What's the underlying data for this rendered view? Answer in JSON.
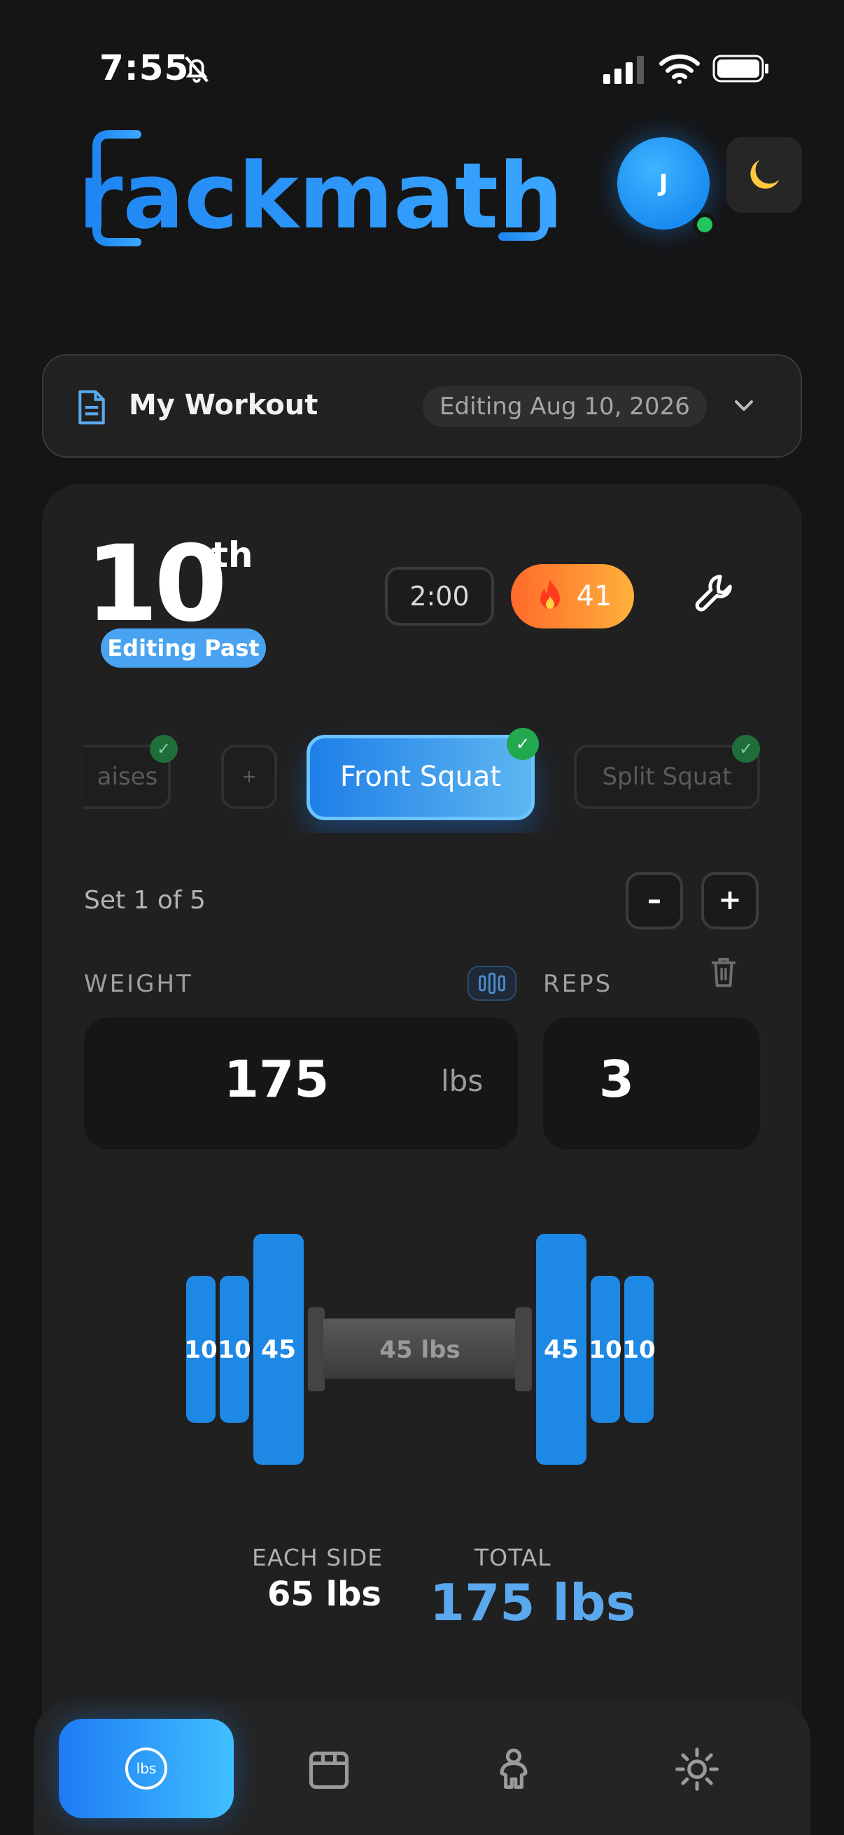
{
  "status_bar": {
    "time": "7:55"
  },
  "brand": {
    "name": "rackmath"
  },
  "profile": {
    "initial": "J",
    "theme_icon": "moon-icon"
  },
  "workout_selector": {
    "title": "My Workout",
    "editing_label": "Editing Aug 10, 2026"
  },
  "day": {
    "number": "10",
    "suffix": "th",
    "badge": "Editing Past",
    "timer": "2:00",
    "streak": "41"
  },
  "exercises": {
    "previous_partial": "aises",
    "add_label": "+",
    "active": "Front Squat",
    "next": "Split Squat"
  },
  "set": {
    "label": "Set 1 of 5",
    "minus": "–",
    "plus": "+"
  },
  "fields": {
    "weight_label": "WEIGHT",
    "reps_label": "REPS",
    "weight_value": "175",
    "weight_unit": "lbs",
    "reps_value": "3"
  },
  "barbell": {
    "bar_label": "45 lbs",
    "left_plates": [
      "10",
      "10",
      "45"
    ],
    "right_plates": [
      "45",
      "10",
      "10"
    ]
  },
  "totals": {
    "each_side_label": "EACH SIDE",
    "each_side_value": "65 lbs",
    "total_label": "TOTAL",
    "total_value": "175 lbs"
  },
  "nav": {
    "items": [
      {
        "name": "calculator",
        "label": "lbs",
        "active": true
      },
      {
        "name": "calendar",
        "active": false
      },
      {
        "name": "body",
        "active": false
      },
      {
        "name": "settings",
        "active": false
      }
    ]
  },
  "colors": {
    "accent": "#1e88f0",
    "streak": "#ff8a30",
    "success": "#22a84e",
    "total": "#5aa8ee"
  }
}
